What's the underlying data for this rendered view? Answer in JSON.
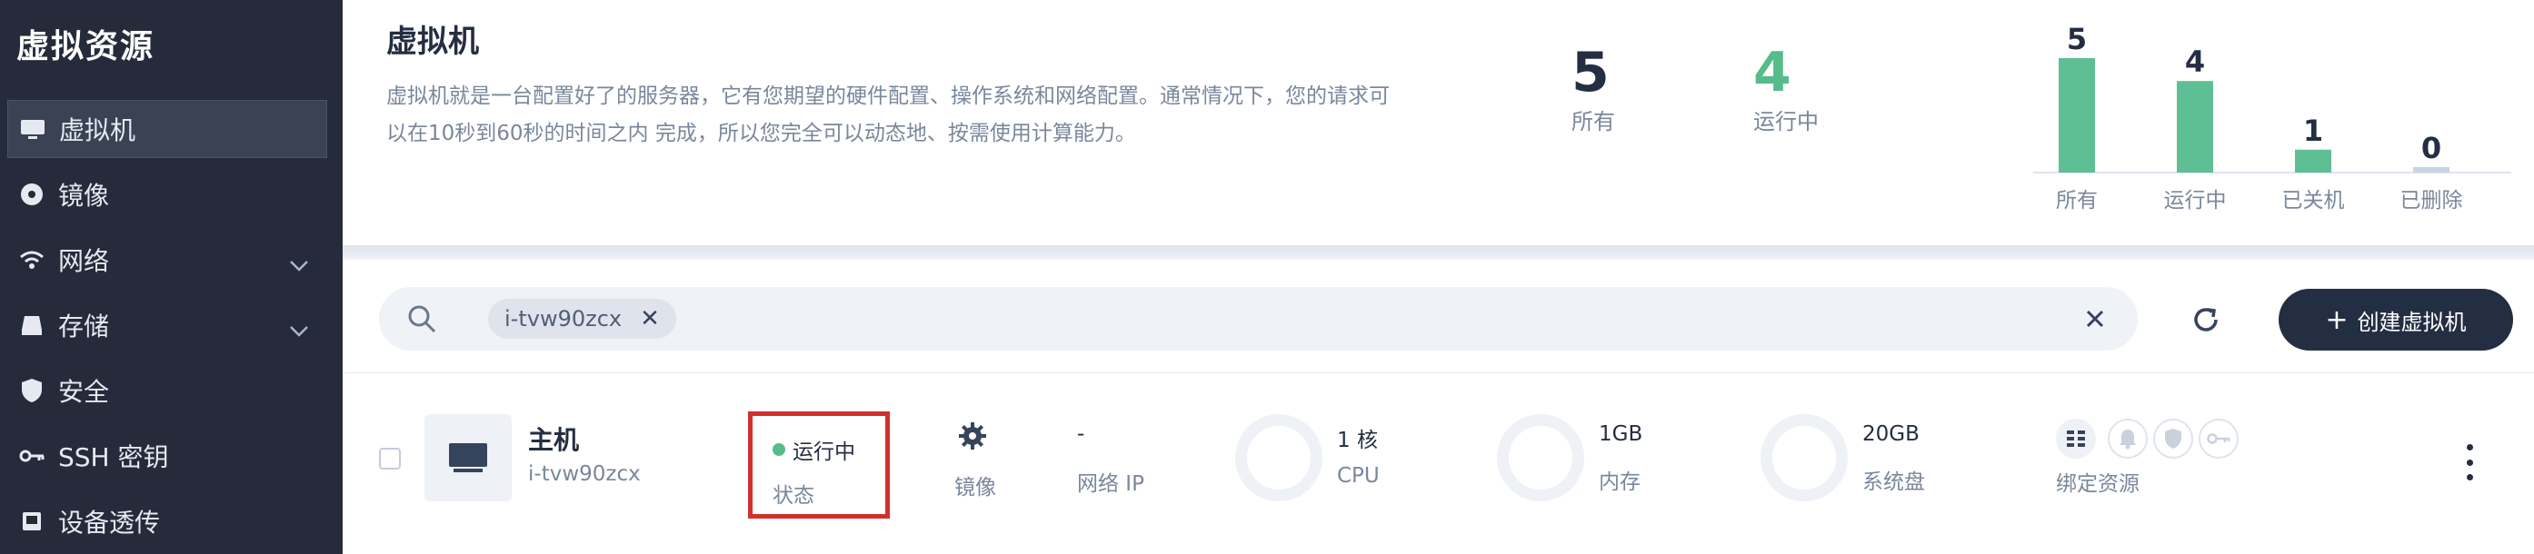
{
  "sidebar": {
    "title": "虚拟资源",
    "items": [
      {
        "label": "虚拟机",
        "icon": "monitor-icon",
        "active": true
      },
      {
        "label": "镜像",
        "icon": "disc-icon"
      },
      {
        "label": "网络",
        "icon": "wifi-icon",
        "expandable": true
      },
      {
        "label": "存储",
        "icon": "storage-icon",
        "expandable": true
      },
      {
        "label": "安全",
        "icon": "shield-icon"
      },
      {
        "label": "SSH 密钥",
        "icon": "key-icon"
      },
      {
        "label": "设备透传",
        "icon": "device-icon"
      }
    ]
  },
  "header": {
    "title": "虚拟机",
    "description": "虚拟机就是一台配置好了的服务器，它有您期望的硬件配置、操作系统和网络配置。通常情况下，您的请求可以在10秒到60秒的时间之内 完成，所以您完全可以动态地、按需使用计算能力。",
    "stats": [
      {
        "value": "5",
        "label": "所有",
        "color": "#242e42"
      },
      {
        "value": "4",
        "label": "运行中",
        "color": "#55bc8a"
      }
    ]
  },
  "chart_data": {
    "type": "bar",
    "categories": [
      "所有",
      "运行中",
      "已关机",
      "已删除"
    ],
    "values": [
      5,
      4,
      1,
      0
    ],
    "colors": [
      "#5fbf94",
      "#5fbf94",
      "#5fbf94",
      "#c9d4e3"
    ],
    "ylim": [
      0,
      5
    ]
  },
  "toolbar": {
    "filter_tag": "i-tvw90zcx",
    "create_label": "创建虚拟机"
  },
  "row": {
    "name": "主机",
    "id": "i-tvw90zcx",
    "status_value": "运行中",
    "status_label": "状态",
    "image_label": "镜像",
    "ip_value": "-",
    "ip_label": "网络 IP",
    "cpu_value": "1 核",
    "cpu_label": "CPU",
    "memory_value": "1GB",
    "memory_label": "内存",
    "disk_value": "20GB",
    "disk_label": "系统盘",
    "bind_label": "绑定资源"
  },
  "colors": {
    "sidebar_bg": "#252b3b",
    "accent_green": "#55bc8a",
    "highlight_red": "#d0312d",
    "primary_dark": "#242e42"
  }
}
